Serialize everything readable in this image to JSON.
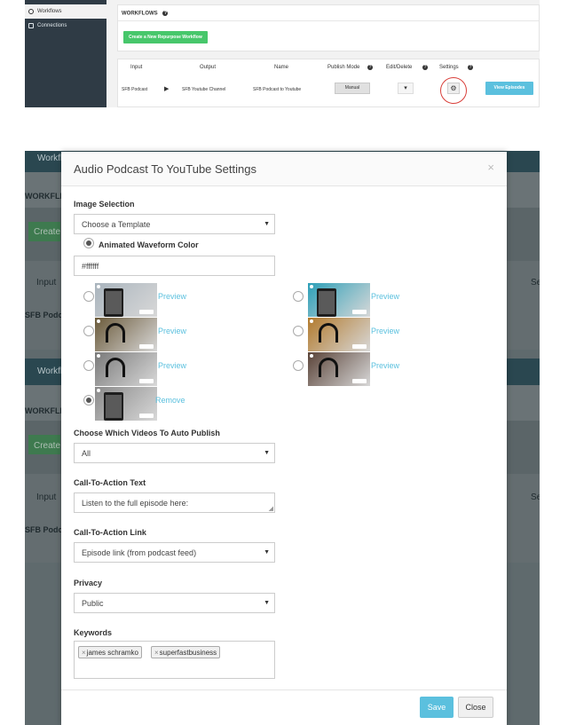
{
  "top": {
    "sidebar": [
      {
        "label": "Workflows",
        "icon": "gear-icon"
      },
      {
        "label": "Connections",
        "icon": "connection-icon"
      }
    ],
    "panel_title": "WORKFLOWS",
    "create_button": "Create a New Repurpose Workflow",
    "columns": [
      "Input",
      "Output",
      "Name",
      "Publish Mode",
      "Edit/Delete",
      "Settings"
    ],
    "row": {
      "input": "SFB Podcast",
      "output": "SFB Youtube Channel",
      "name": "SFB Podcast to Youtube",
      "publish_mode": "Manual",
      "view_button": "View Episodes"
    }
  },
  "backdrop": {
    "labels": [
      "Workfl",
      "WORKFLI",
      "Create",
      "Input",
      "SFB Podc",
      "Workfl",
      "WORKFLI",
      "Create",
      "Input",
      "SFB Podc",
      "Se",
      "Se"
    ]
  },
  "modal": {
    "title": "Audio Podcast To YouTube Settings",
    "close": "×",
    "image_selection_label": "Image Selection",
    "template_select": "Choose a Template",
    "waveform_label": "Animated Waveform Color",
    "waveform_color": "#ffffff",
    "thumbnails": [
      {
        "action": "Preview",
        "selected": false,
        "bg": "#a9b4bd"
      },
      {
        "action": "Preview",
        "selected": false,
        "bg": "#2c9fb8"
      },
      {
        "action": "Preview",
        "selected": false,
        "bg": "#6b5a3a"
      },
      {
        "action": "Preview",
        "selected": false,
        "bg": "#b27a2d"
      },
      {
        "action": "Preview",
        "selected": false,
        "bg": "#7a7a7a"
      },
      {
        "action": "Preview",
        "selected": false,
        "bg": "#5a4338"
      },
      {
        "action": "Remove",
        "selected": true,
        "bg": "#8a8a8a"
      }
    ],
    "auto_publish_label": "Choose Which Videos To Auto Publish",
    "auto_publish_value": "All",
    "cta_text_label": "Call-To-Action Text",
    "cta_text_value": "Listen to the full episode here:",
    "cta_link_label": "Call-To-Action Link",
    "cta_link_value": "Episode link (from podcast feed)",
    "privacy_label": "Privacy",
    "privacy_value": "Public",
    "keywords_label": "Keywords",
    "keywords": [
      "james schramko",
      "superfastbusiness"
    ],
    "save": "Save",
    "close_button": "Close"
  }
}
